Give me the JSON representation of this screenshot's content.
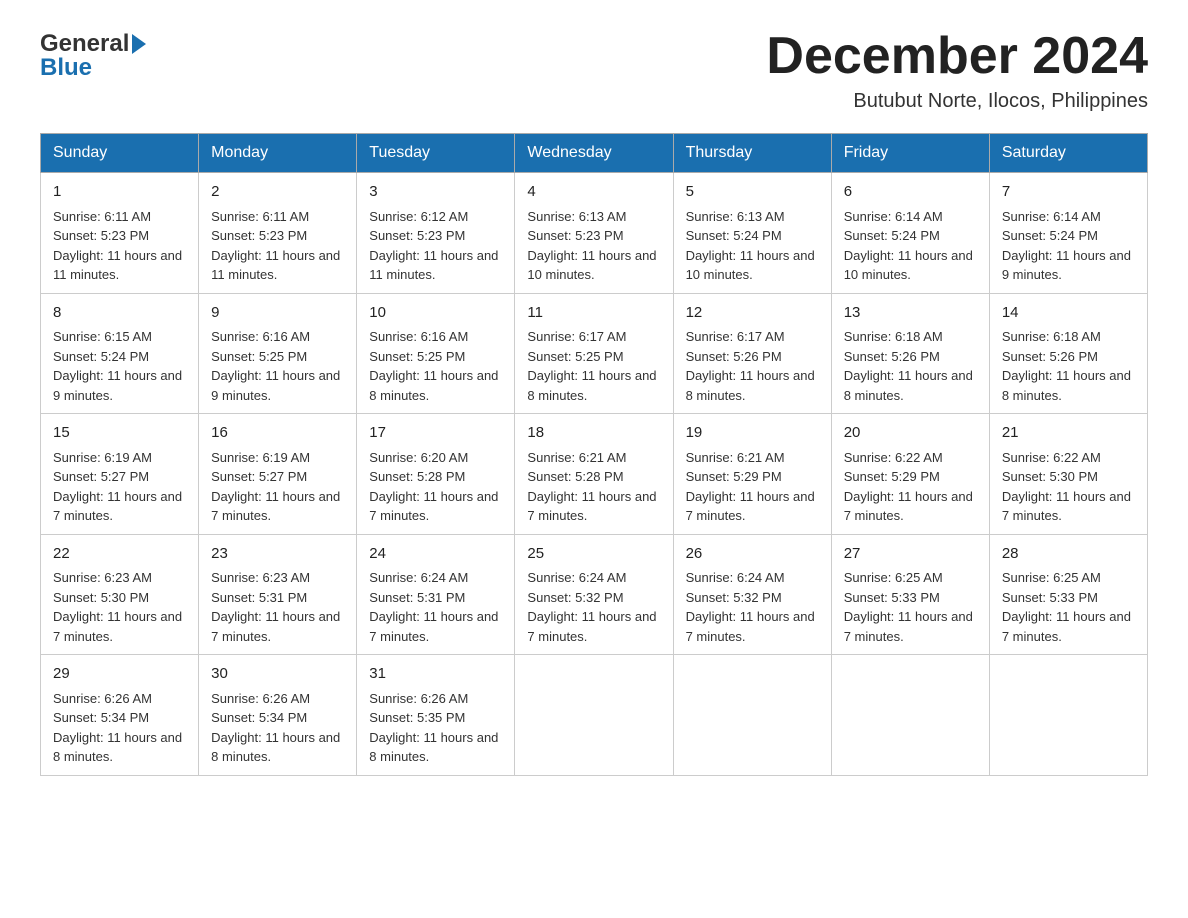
{
  "header": {
    "month_year": "December 2024",
    "location": "Butubut Norte, Ilocos, Philippines"
  },
  "columns": [
    "Sunday",
    "Monday",
    "Tuesday",
    "Wednesday",
    "Thursday",
    "Friday",
    "Saturday"
  ],
  "weeks": [
    [
      {
        "day": "1",
        "sunrise": "6:11 AM",
        "sunset": "5:23 PM",
        "daylight": "11 hours and 11 minutes."
      },
      {
        "day": "2",
        "sunrise": "6:11 AM",
        "sunset": "5:23 PM",
        "daylight": "11 hours and 11 minutes."
      },
      {
        "day": "3",
        "sunrise": "6:12 AM",
        "sunset": "5:23 PM",
        "daylight": "11 hours and 11 minutes."
      },
      {
        "day": "4",
        "sunrise": "6:13 AM",
        "sunset": "5:23 PM",
        "daylight": "11 hours and 10 minutes."
      },
      {
        "day": "5",
        "sunrise": "6:13 AM",
        "sunset": "5:24 PM",
        "daylight": "11 hours and 10 minutes."
      },
      {
        "day": "6",
        "sunrise": "6:14 AM",
        "sunset": "5:24 PM",
        "daylight": "11 hours and 10 minutes."
      },
      {
        "day": "7",
        "sunrise": "6:14 AM",
        "sunset": "5:24 PM",
        "daylight": "11 hours and 9 minutes."
      }
    ],
    [
      {
        "day": "8",
        "sunrise": "6:15 AM",
        "sunset": "5:24 PM",
        "daylight": "11 hours and 9 minutes."
      },
      {
        "day": "9",
        "sunrise": "6:16 AM",
        "sunset": "5:25 PM",
        "daylight": "11 hours and 9 minutes."
      },
      {
        "day": "10",
        "sunrise": "6:16 AM",
        "sunset": "5:25 PM",
        "daylight": "11 hours and 8 minutes."
      },
      {
        "day": "11",
        "sunrise": "6:17 AM",
        "sunset": "5:25 PM",
        "daylight": "11 hours and 8 minutes."
      },
      {
        "day": "12",
        "sunrise": "6:17 AM",
        "sunset": "5:26 PM",
        "daylight": "11 hours and 8 minutes."
      },
      {
        "day": "13",
        "sunrise": "6:18 AM",
        "sunset": "5:26 PM",
        "daylight": "11 hours and 8 minutes."
      },
      {
        "day": "14",
        "sunrise": "6:18 AM",
        "sunset": "5:26 PM",
        "daylight": "11 hours and 8 minutes."
      }
    ],
    [
      {
        "day": "15",
        "sunrise": "6:19 AM",
        "sunset": "5:27 PM",
        "daylight": "11 hours and 7 minutes."
      },
      {
        "day": "16",
        "sunrise": "6:19 AM",
        "sunset": "5:27 PM",
        "daylight": "11 hours and 7 minutes."
      },
      {
        "day": "17",
        "sunrise": "6:20 AM",
        "sunset": "5:28 PM",
        "daylight": "11 hours and 7 minutes."
      },
      {
        "day": "18",
        "sunrise": "6:21 AM",
        "sunset": "5:28 PM",
        "daylight": "11 hours and 7 minutes."
      },
      {
        "day": "19",
        "sunrise": "6:21 AM",
        "sunset": "5:29 PM",
        "daylight": "11 hours and 7 minutes."
      },
      {
        "day": "20",
        "sunrise": "6:22 AM",
        "sunset": "5:29 PM",
        "daylight": "11 hours and 7 minutes."
      },
      {
        "day": "21",
        "sunrise": "6:22 AM",
        "sunset": "5:30 PM",
        "daylight": "11 hours and 7 minutes."
      }
    ],
    [
      {
        "day": "22",
        "sunrise": "6:23 AM",
        "sunset": "5:30 PM",
        "daylight": "11 hours and 7 minutes."
      },
      {
        "day": "23",
        "sunrise": "6:23 AM",
        "sunset": "5:31 PM",
        "daylight": "11 hours and 7 minutes."
      },
      {
        "day": "24",
        "sunrise": "6:24 AM",
        "sunset": "5:31 PM",
        "daylight": "11 hours and 7 minutes."
      },
      {
        "day": "25",
        "sunrise": "6:24 AM",
        "sunset": "5:32 PM",
        "daylight": "11 hours and 7 minutes."
      },
      {
        "day": "26",
        "sunrise": "6:24 AM",
        "sunset": "5:32 PM",
        "daylight": "11 hours and 7 minutes."
      },
      {
        "day": "27",
        "sunrise": "6:25 AM",
        "sunset": "5:33 PM",
        "daylight": "11 hours and 7 minutes."
      },
      {
        "day": "28",
        "sunrise": "6:25 AM",
        "sunset": "5:33 PM",
        "daylight": "11 hours and 7 minutes."
      }
    ],
    [
      {
        "day": "29",
        "sunrise": "6:26 AM",
        "sunset": "5:34 PM",
        "daylight": "11 hours and 8 minutes."
      },
      {
        "day": "30",
        "sunrise": "6:26 AM",
        "sunset": "5:34 PM",
        "daylight": "11 hours and 8 minutes."
      },
      {
        "day": "31",
        "sunrise": "6:26 AM",
        "sunset": "5:35 PM",
        "daylight": "11 hours and 8 minutes."
      },
      null,
      null,
      null,
      null
    ]
  ],
  "labels": {
    "sunrise": "Sunrise: ",
    "sunset": "Sunset: ",
    "daylight": "Daylight: "
  }
}
